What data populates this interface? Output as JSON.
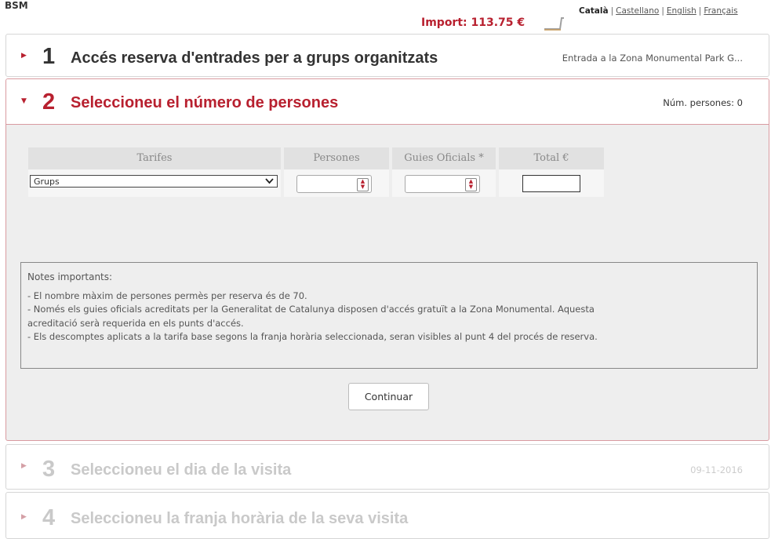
{
  "header": {
    "brand": "BSM",
    "import_text": "Import: 113.75 €",
    "languages": [
      "Català",
      "Castellano",
      "English",
      "Français"
    ],
    "separator": "|"
  },
  "steps": [
    {
      "number": "1",
      "title": "Accés reserva d'entrades per a grups organitzats",
      "summary": "Entrada a la Zona Monumental Park G..."
    },
    {
      "number": "2",
      "title": "Seleccioneu el número de persones",
      "summary": "Núm. persones: 0"
    },
    {
      "number": "3",
      "title": "Seleccioneu el dia de la visita",
      "summary": "09-11-2016"
    },
    {
      "number": "4",
      "title": "Seleccioneu la franja horària de la seva visita",
      "summary": ""
    }
  ],
  "form": {
    "headers": [
      "Tarifes",
      "Persones",
      "Guies Oficials *",
      "Total €"
    ],
    "tarifa_selected": "Grups",
    "persones_value": "",
    "guies_value": "",
    "total_value": ""
  },
  "notes": {
    "title": "Notes importants:",
    "lines": [
      "- El nombre màxim de persones permès per reserva és de 70.",
      "- Només els guies oficials acreditats per la Generalitat de Catalunya disposen d'accés gratuït a la Zona Monumental. Aquesta",
      "acreditació serà requerida en els punts d'accés.",
      "- Els descomptes aplicats a la tarifa base segons la franja horària seleccionada, seran visibles al punt 4 del procés de reserva."
    ]
  },
  "continue_label": "Continuar",
  "colors": {
    "accent": "#b8202f",
    "inactive_text": "#c9c9c9",
    "panel_bg": "#eeeeee"
  }
}
